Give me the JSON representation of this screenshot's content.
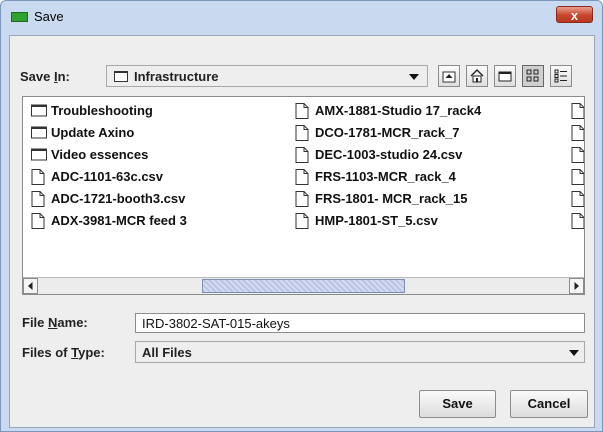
{
  "window": {
    "title": "Save",
    "close_symbol": "x"
  },
  "save_in": {
    "label_pre": "Save ",
    "label_key": "I",
    "label_post": "n:",
    "value": "Infrastructure"
  },
  "toolbar": [
    "up-one-level-icon",
    "home-icon",
    "new-folder-icon",
    "list-view-icon",
    "details-view-icon"
  ],
  "files": {
    "col1": [
      {
        "name": "Troubleshooting",
        "icon": "folder-icon"
      },
      {
        "name": "Update Axino",
        "icon": "folder-icon"
      },
      {
        "name": "Video essences",
        "icon": "folder-icon"
      },
      {
        "name": "ADC-1101-63c.csv",
        "icon": "file-icon"
      },
      {
        "name": "ADC-1721-booth3.csv",
        "icon": "file-icon"
      },
      {
        "name": "ADX-3981-MCR feed 3",
        "icon": "file-icon"
      }
    ],
    "col2": [
      {
        "name": "AMX-1881-Studio 17_rack4",
        "icon": "file-icon"
      },
      {
        "name": "DCO-1781-MCR_rack_7",
        "icon": "file-icon"
      },
      {
        "name": "DEC-1003-studio 24.csv",
        "icon": "file-icon"
      },
      {
        "name": "FRS-1103-MCR_rack_4",
        "icon": "file-icon"
      },
      {
        "name": "FRS-1801- MCR_rack_15",
        "icon": "file-icon"
      },
      {
        "name": "HMP-1801-ST_5.csv",
        "icon": "file-icon"
      }
    ]
  },
  "file_name": {
    "label_pre": "File ",
    "label_key": "N",
    "label_post": "ame:",
    "value": "IRD-3802-SAT-015-akeys"
  },
  "file_type": {
    "label_pre": "Files of ",
    "label_key": "T",
    "label_post": "ype:",
    "value": "All Files"
  },
  "buttons": {
    "save": "Save",
    "cancel": "Cancel"
  }
}
